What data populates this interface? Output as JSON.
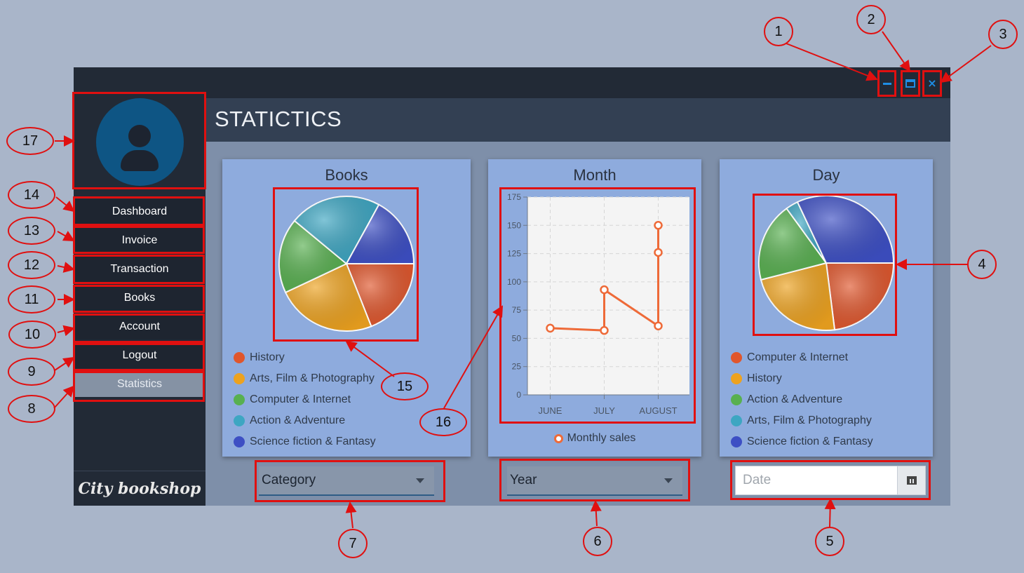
{
  "window": {
    "controls": {
      "minimize": "minimize-icon",
      "maximize": "maximize-icon",
      "close": "×"
    }
  },
  "sidebar": {
    "avatar_icon": "user-icon",
    "items": [
      {
        "label": "Dashboard"
      },
      {
        "label": "Invoice"
      },
      {
        "label": "Transaction"
      },
      {
        "label": "Books"
      },
      {
        "label": "Account"
      },
      {
        "label": "Logout"
      },
      {
        "label": "Statistics",
        "active": true
      }
    ],
    "brand": "City bookshop"
  },
  "header": {
    "title": "STATICTICS"
  },
  "books_card": {
    "title": "Books",
    "legend": [
      {
        "label": "History",
        "color": "#e0562c"
      },
      {
        "label": "Arts, Film & Photography",
        "color": "#eda21f"
      },
      {
        "label": "Computer & Internet",
        "color": "#58b050"
      },
      {
        "label": "Action & Adventure",
        "color": "#3da6c2"
      },
      {
        "label": "Science  fiction & Fantasy",
        "color": "#3d4fc4"
      }
    ],
    "filter": {
      "label": "Category"
    }
  },
  "month_card": {
    "title": "Month",
    "legend": "Monthly sales",
    "filter": {
      "label": "Year"
    }
  },
  "day_card": {
    "title": "Day",
    "legend": [
      {
        "label": "Computer & Internet",
        "color": "#e0562c"
      },
      {
        "label": "History",
        "color": "#eda21f"
      },
      {
        "label": "Action & Adventure",
        "color": "#58b050"
      },
      {
        "label": "Arts, Film & Photography",
        "color": "#3da6c2"
      },
      {
        "label": "Science  fiction & Fantasy",
        "color": "#3d4fc4"
      }
    ],
    "filter": {
      "placeholder": "Date",
      "button_icon": "calendar-icon"
    }
  },
  "chart_data": [
    {
      "type": "pie",
      "title": "Books",
      "labels": [
        "History",
        "Arts, Film & Photography",
        "Computer & Internet",
        "Action & Adventure",
        "Science  fiction & Fantasy"
      ],
      "values": [
        19,
        24,
        18,
        22,
        17
      ],
      "colors": [
        "#e0562c",
        "#eda21f",
        "#58b050",
        "#3da6c2",
        "#3d4fc4"
      ]
    },
    {
      "type": "line",
      "title": "Month",
      "categories": [
        "JUNE",
        "JULY",
        "AUGUST"
      ],
      "series": [
        {
          "name": "Monthly sales",
          "points": [
            {
              "x": "JUNE",
              "y": 59
            },
            {
              "x": "JULY",
              "y": 57
            },
            {
              "x": "JULY",
              "y": 93
            },
            {
              "x": "AUGUST",
              "y": 61
            },
            {
              "x": "AUGUST",
              "y": 126
            },
            {
              "x": "AUGUST",
              "y": 150
            }
          ]
        }
      ],
      "ylim": [
        0,
        175
      ],
      "yticks": [
        0,
        25,
        50,
        75,
        100,
        125,
        150,
        175
      ],
      "grid": true,
      "legend": "bottom",
      "color": "#ee6a38"
    },
    {
      "type": "pie",
      "title": "Day",
      "labels": [
        "Computer & Internet",
        "History",
        "Action & Adventure",
        "Arts, Film & Photography",
        "Science  fiction & Fantasy"
      ],
      "values": [
        23,
        23,
        19,
        3,
        32
      ],
      "colors": [
        "#e0562c",
        "#eda21f",
        "#58b050",
        "#3da6c2",
        "#3d4fc4"
      ]
    }
  ],
  "annotations": {
    "numbers": [
      "1",
      "2",
      "3",
      "4",
      "5",
      "6",
      "7",
      "8",
      "9",
      "10",
      "11",
      "12",
      "13",
      "14",
      "15",
      "16",
      "17"
    ]
  }
}
